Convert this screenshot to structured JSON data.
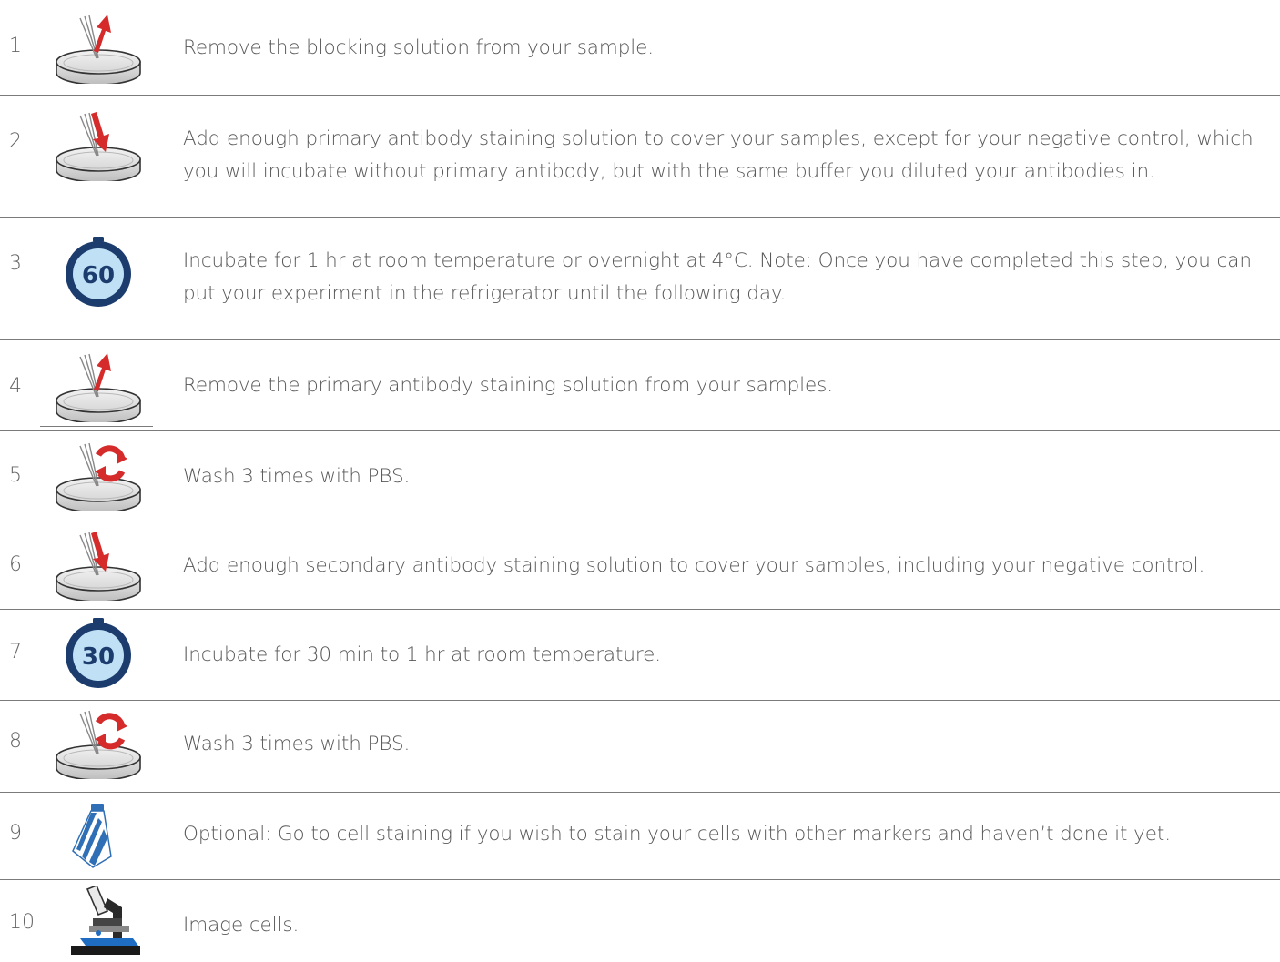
{
  "steps": [
    {
      "number": "1",
      "icon": "remove-pipette-icon",
      "text": "Remove the blocking solution from your sample."
    },
    {
      "number": "2",
      "icon": "add-pipette-icon",
      "text": "Add enough primary antibody staining solution to cover your samples, except for your negative control, which you will incubate without primary antibody, but with the same buffer you diluted your antibodies in."
    },
    {
      "number": "3",
      "icon": "timer-60-icon",
      "timer_label": "60",
      "text": "Incubate for 1 hr at room temperature or overnight at 4°C. Note: Once you have completed this step, you can put your experiment in the refrigerator until the following day."
    },
    {
      "number": "4",
      "icon": "remove-pipette-icon",
      "text": "Remove the primary antibody staining solution from your samples."
    },
    {
      "number": "5",
      "icon": "wash-icon",
      "text": "Wash 3 times with PBS."
    },
    {
      "number": "6",
      "icon": "add-pipette-icon",
      "text": "Add enough secondary antibody staining solution to cover your samples, including your negative control."
    },
    {
      "number": "7",
      "icon": "timer-30-icon",
      "timer_label": "30",
      "text": "Incubate for 30 min to 1 hr at room temperature."
    },
    {
      "number": "8",
      "icon": "wash-icon",
      "text": "Wash 3 times with PBS."
    },
    {
      "number": "9",
      "icon": "tie-icon",
      "text": "Optional: Go to cell staining if you wish to stain your cells with other markers and haven’t done it yet."
    },
    {
      "number": "10",
      "icon": "microscope-icon",
      "text": "Image cells."
    }
  ],
  "colors": {
    "arrow_red": "#d62b2b",
    "timer_navy": "#1d3c6e",
    "timer_face": "#bfe0f5",
    "tie_blue": "#2f6fb5",
    "microscope_blue": "#1f6dc2"
  }
}
